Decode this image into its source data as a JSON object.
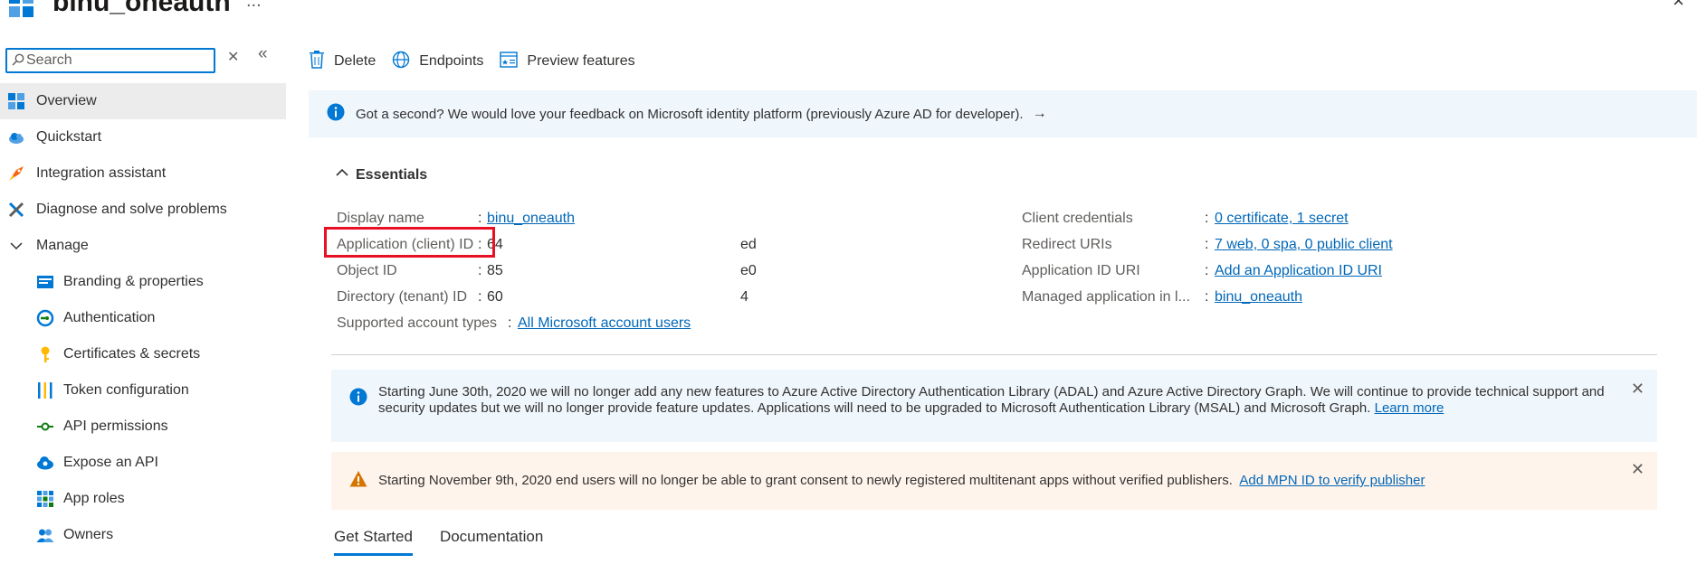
{
  "header": {
    "title": "binu_oneauth",
    "more": "...",
    "close": "×"
  },
  "sidebar": {
    "search_placeholder": "Search",
    "clear_symbol": "✕",
    "collapse_symbol": "«",
    "items": [
      {
        "label": "Overview",
        "icon": "overview-grid-icon"
      },
      {
        "label": "Quickstart",
        "icon": "cloud-icon"
      },
      {
        "label": "Integration assistant",
        "icon": "rocket-icon"
      },
      {
        "label": "Diagnose and solve problems",
        "icon": "wrench-icon"
      },
      {
        "label": "Manage",
        "icon": "chevron-down-icon"
      },
      {
        "label": "Branding & properties",
        "icon": "branding-icon"
      },
      {
        "label": "Authentication",
        "icon": "authentication-icon"
      },
      {
        "label": "Certificates & secrets",
        "icon": "key-icon"
      },
      {
        "label": "Token configuration",
        "icon": "token-bars-icon"
      },
      {
        "label": "API permissions",
        "icon": "api-permissions-icon"
      },
      {
        "label": "Expose an API",
        "icon": "cloud-api-icon"
      },
      {
        "label": "App roles",
        "icon": "app-roles-icon"
      },
      {
        "label": "Owners",
        "icon": "owners-icon"
      }
    ]
  },
  "toolbar": {
    "delete_label": "Delete",
    "endpoints_label": "Endpoints",
    "preview_label": "Preview features"
  },
  "feedback": {
    "text": "Got a second? We would love your feedback on Microsoft identity platform (previously Azure AD for developer).",
    "arrow": "→"
  },
  "essentials": {
    "title": "Essentials",
    "left": [
      {
        "label": "Display name",
        "value": "binu_oneauth",
        "value_end": "",
        "is_link": true
      },
      {
        "label": "Application (client) ID",
        "value": "64",
        "value_end": "ed",
        "is_link": false
      },
      {
        "label": "Object ID",
        "value": "85",
        "value_end": "e0",
        "is_link": false
      },
      {
        "label": "Directory (tenant) ID",
        "value": "60",
        "value_end": "4",
        "is_link": false
      },
      {
        "label": "Supported account types",
        "value": "All Microsoft account users",
        "value_end": "",
        "is_link": true
      }
    ],
    "right": [
      {
        "label": "Client credentials",
        "value": "0 certificate, 1 secret"
      },
      {
        "label": "Redirect URIs",
        "value": "7 web, 0 spa, 0 public client"
      },
      {
        "label": "Application ID URI",
        "value": "Add an Application ID URI"
      },
      {
        "label": "Managed application in l...",
        "value": "binu_oneauth"
      }
    ],
    "colon": ":"
  },
  "notices": {
    "adal": {
      "text": "Starting June 30th, 2020 we will no longer add any new features to Azure Active Directory Authentication Library (ADAL) and Azure Active Directory Graph. We will continue to provide technical support and security updates but we will no longer provide feature updates. Applications will need to be upgraded to Microsoft Authentication Library (MSAL) and Microsoft Graph.",
      "link": "Learn more"
    },
    "consent": {
      "text": "Starting November 9th, 2020 end users will no longer be able to grant consent to newly registered multitenant apps without verified publishers.",
      "link": "Add MPN ID to verify publisher"
    },
    "close": "✕"
  },
  "tabs": [
    {
      "label": "Get Started",
      "active": true
    },
    {
      "label": "Documentation",
      "active": false
    }
  ],
  "colors": {
    "accent": "#0078d4",
    "link": "#0067b8",
    "highlight": "#e81123",
    "info_bg": "#eff6fc",
    "warn_bg": "#fff4ec"
  }
}
